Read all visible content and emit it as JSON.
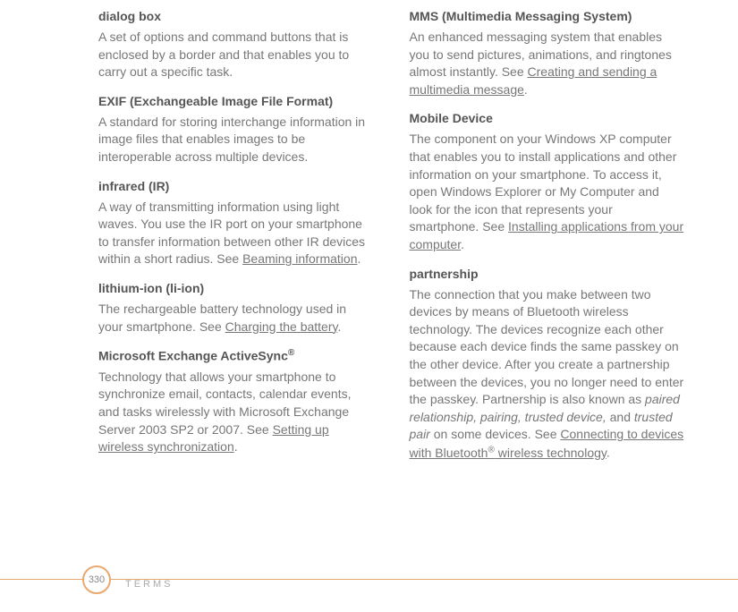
{
  "left": {
    "dialog_box": {
      "term": "dialog box",
      "def": "A set of options and command buttons that is enclosed by a border and that enables you to carry out a specific task."
    },
    "exif": {
      "term": "EXIF (Exchangeable Image File Format)",
      "def": "A standard for storing interchange information in image files that enables images to be interoperable across multiple devices."
    },
    "infrared": {
      "term": "infrared (IR)",
      "def_pre": "A way of transmitting information using light waves. You use the IR port on your smartphone to transfer information between other IR devices within a short radius. See ",
      "link": "Beaming information",
      "def_post": "."
    },
    "lithium": {
      "term": "lithium-ion (li-ion)",
      "def_pre": "The rechargeable battery technology used in your smartphone. See ",
      "link": "Charging the battery",
      "def_post": "."
    },
    "activesync": {
      "term_pre": "Microsoft Exchange ActiveSync",
      "term_sup": "®",
      "def_pre": "Technology that allows your smartphone to synchronize email, contacts, calendar events, and tasks wirelessly with Microsoft Exchange Server 2003 SP2 or 2007. See ",
      "link": "Setting up wireless synchronization",
      "def_post": "."
    }
  },
  "right": {
    "mms": {
      "term": "MMS (Multimedia Messaging System)",
      "def_pre": "An enhanced messaging system that enables you to send pictures, animations, and ringtones almost instantly. See ",
      "link": "Creating and sending a multimedia message",
      "def_post": "."
    },
    "mobile": {
      "term": "Mobile Device",
      "def_pre": "The component on your Windows XP computer that enables you to install applications and other information on your smartphone. To access it, open Windows Explorer or My Computer and look for the icon that represents your smartphone. See ",
      "link": "Installing applications from your computer",
      "def_post": "."
    },
    "partnership": {
      "term": "partnership",
      "def_pre": "The connection that you make between two devices by means of Bluetooth wireless technology. The devices recognize each other because each device finds the same passkey on the other device. After you create a partnership between the devices, you no longer need to enter the passkey. Partnership is also known as ",
      "italic1": "paired relationship, pairing, trusted device,",
      "mid": " and ",
      "italic2": "trusted pair",
      "def_post1": " on some devices. See ",
      "link_pre": "Connecting to devices with Bluetooth",
      "link_sup": "®",
      "link_post": " wireless technology",
      "def_post2": "."
    }
  },
  "footer": {
    "page": "330",
    "label": "TERMS"
  }
}
